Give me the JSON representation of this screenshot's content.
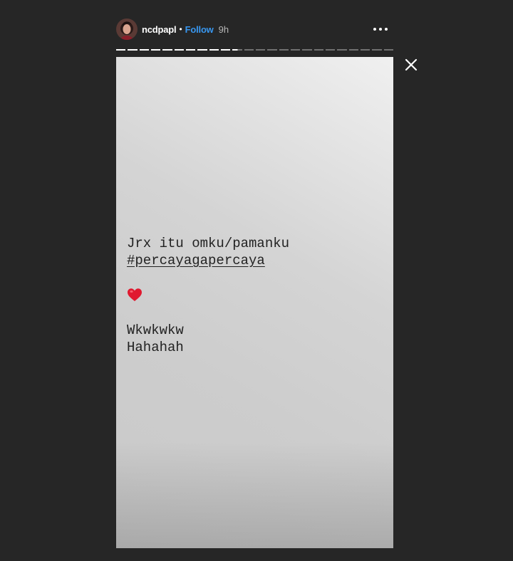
{
  "header": {
    "username": "ncdpapl",
    "separator": "•",
    "follow_label": "Follow",
    "time_ago": "9h",
    "more_icon": "more-horizontal-icon",
    "follow_color": "#3897f0"
  },
  "progress": {
    "total_segments": 24,
    "completed_segments": 10,
    "current_fraction": 0.55
  },
  "close_icon": "close-icon",
  "story": {
    "lines": [
      "Jrx itu omku/pamanku",
      "#percayagapercaya"
    ],
    "emoji": "heart-emoji-icon",
    "lines_after": [
      "Wkwkwkw",
      "Hahahah"
    ]
  }
}
